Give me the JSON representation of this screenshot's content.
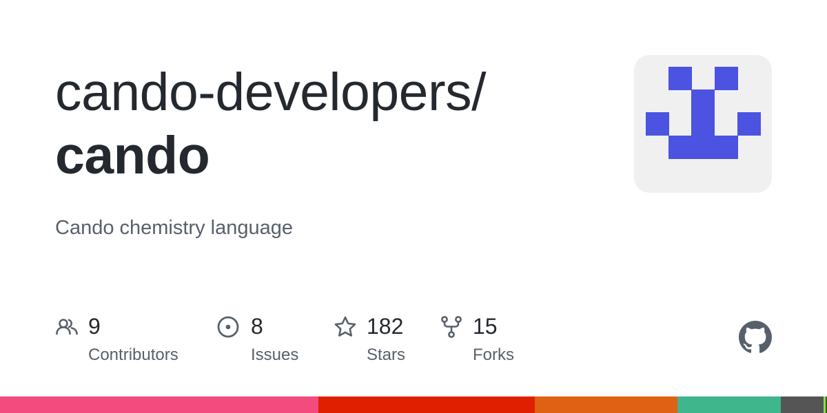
{
  "repo": {
    "owner": "cando-developers/",
    "name": "cando",
    "description": "Cando chemistry language"
  },
  "avatar": {
    "icon": "cando-pixel-logo",
    "color": "#4b53e0",
    "background": "#f0f0f0"
  },
  "stats": {
    "contributors": {
      "count": "9",
      "label": "Contributors",
      "icon": "people-icon"
    },
    "issues": {
      "count": "8",
      "label": "Issues",
      "icon": "issue-opened-icon"
    },
    "stars": {
      "count": "182",
      "label": "Stars",
      "icon": "star-icon"
    },
    "forks": {
      "count": "15",
      "label": "Forks",
      "icon": "repo-forked-icon"
    }
  },
  "github_logo": {
    "icon": "github-mark-icon",
    "color": "#57606a"
  },
  "languages": [
    {
      "color": "#f34b7d",
      "share": 0.385
    },
    {
      "color": "#e01e00",
      "share": 0.262
    },
    {
      "color": "#e06014",
      "share": 0.172
    },
    {
      "color": "#3fb68b",
      "share": 0.125
    },
    {
      "color": "#555555",
      "share": 0.052
    },
    {
      "color": "#89e051",
      "share": 0.002
    },
    {
      "color": "#3d6117",
      "share": 0.002
    }
  ]
}
